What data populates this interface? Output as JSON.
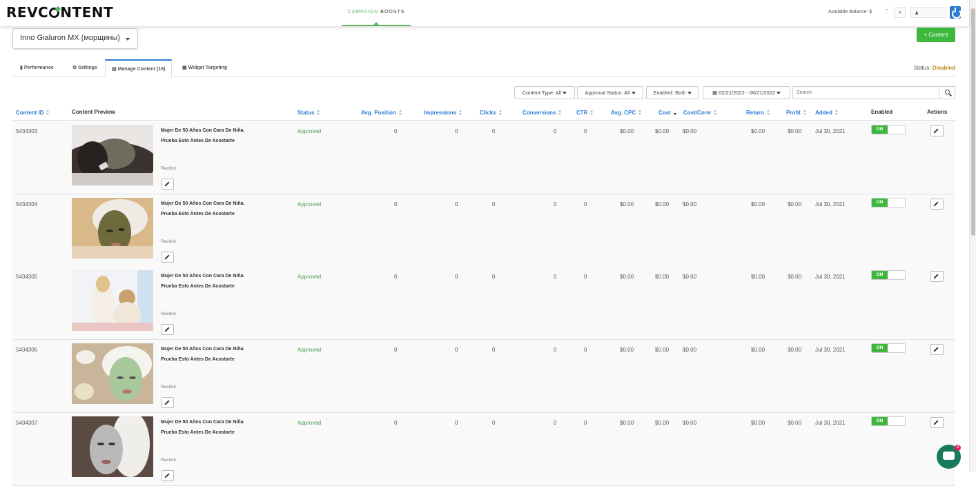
{
  "header": {
    "logo": "REVCONTENT",
    "nav_active_a": "CAMPAIGN",
    "nav_active_b": "BOOSTS",
    "balance_label": "Available Balance: $",
    "add_button": "+",
    "power_icon": "power-icon"
  },
  "campaign": {
    "name": "Inno Gialuron MX (морщины)",
    "add_content_label": "+ Content"
  },
  "tabs": [
    {
      "label": "Performance",
      "icon": "bar-chart-icon"
    },
    {
      "label": "Settings",
      "icon": "gear-icon"
    },
    {
      "label": "Manage Content (16)",
      "icon": "file-icon"
    },
    {
      "label": "Widget Targeting",
      "icon": "grid-icon"
    }
  ],
  "status": {
    "label": "Status:",
    "value": "Disabled"
  },
  "filters": {
    "content_type": "Content Type: All",
    "approval_status": "Approval Status: All",
    "enabled": "Enabled: Both",
    "date_range": "02/21/2022 - 08/21/2022",
    "search_placeholder": "Search"
  },
  "columns": [
    "Content ID",
    "Content Preview",
    "Status",
    "Avg. Position",
    "Impressions",
    "Clicks",
    "Conversions",
    "CTR",
    "Avg. CPC",
    "Cost",
    "Cost/Conv",
    "Return",
    "Profit",
    "Added",
    "Enabled",
    "Actions"
  ],
  "rows": [
    {
      "id": "5434303",
      "headline": "Mujer De 50 Años Con Cara De Niña. Prueba Esto Antes De Acostarte",
      "brand": "Rechiol",
      "status": "Approved",
      "avg_position": "0",
      "impressions": "0",
      "clicks": "0",
      "conversions": "0",
      "ctr": "0",
      "avg_cpc": "$0.00",
      "cost": "$0.00",
      "cost_conv": "$0.00",
      "return": "$0.00",
      "profit": "$0.00",
      "added": "Jul 30, 2021",
      "enabled": "ON"
    },
    {
      "id": "5434304",
      "headline": "Mujer De 50 Años Con Cara De Niña. Prueba Esto Antes De Acostarte",
      "brand": "Rechiol",
      "status": "Approved",
      "avg_position": "0",
      "impressions": "0",
      "clicks": "0",
      "conversions": "0",
      "ctr": "0",
      "avg_cpc": "$0.00",
      "cost": "$0.00",
      "cost_conv": "$0.00",
      "return": "$0.00",
      "profit": "$0.00",
      "added": "Jul 30, 2021",
      "enabled": "ON"
    },
    {
      "id": "5434305",
      "headline": "Mujer De 50 Años Con Cara De Niña. Prueba Esto Antes De Acostarte",
      "brand": "Rechiol",
      "status": "Approved",
      "avg_position": "0",
      "impressions": "0",
      "clicks": "0",
      "conversions": "0",
      "ctr": "0",
      "avg_cpc": "$0.00",
      "cost": "$0.00",
      "cost_conv": "$0.00",
      "return": "$0.00",
      "profit": "$0.00",
      "added": "Jul 30, 2021",
      "enabled": "ON"
    },
    {
      "id": "5434306",
      "headline": "Mujer De 50 Años Con Cara De Niña. Prueba Esto Antes De Acostarte",
      "brand": "Rechiol",
      "status": "Approved",
      "avg_position": "0",
      "impressions": "0",
      "clicks": "0",
      "conversions": "0",
      "ctr": "0",
      "avg_cpc": "$0.00",
      "cost": "$0.00",
      "cost_conv": "$0.00",
      "return": "$0.00",
      "profit": "$0.00",
      "added": "Jul 30, 2021",
      "enabled": "ON"
    },
    {
      "id": "5434307",
      "headline": "Mujer De 50 Años Con Cara De Niña. Prueba Esto Antes De Acostarte",
      "brand": "Rechiol",
      "status": "Approved",
      "avg_position": "0",
      "impressions": "0",
      "clicks": "0",
      "conversions": "0",
      "ctr": "0",
      "avg_cpc": "$0.00",
      "cost": "$0.00",
      "cost_conv": "$0.00",
      "return": "$0.00",
      "profit": "$0.00",
      "added": "Jul 30, 2021",
      "enabled": "ON"
    }
  ],
  "chat": {
    "badge": "3"
  },
  "colors": {
    "accent": "#2a7bd4",
    "green": "#3db83d",
    "status_warning": "#b8860b"
  }
}
